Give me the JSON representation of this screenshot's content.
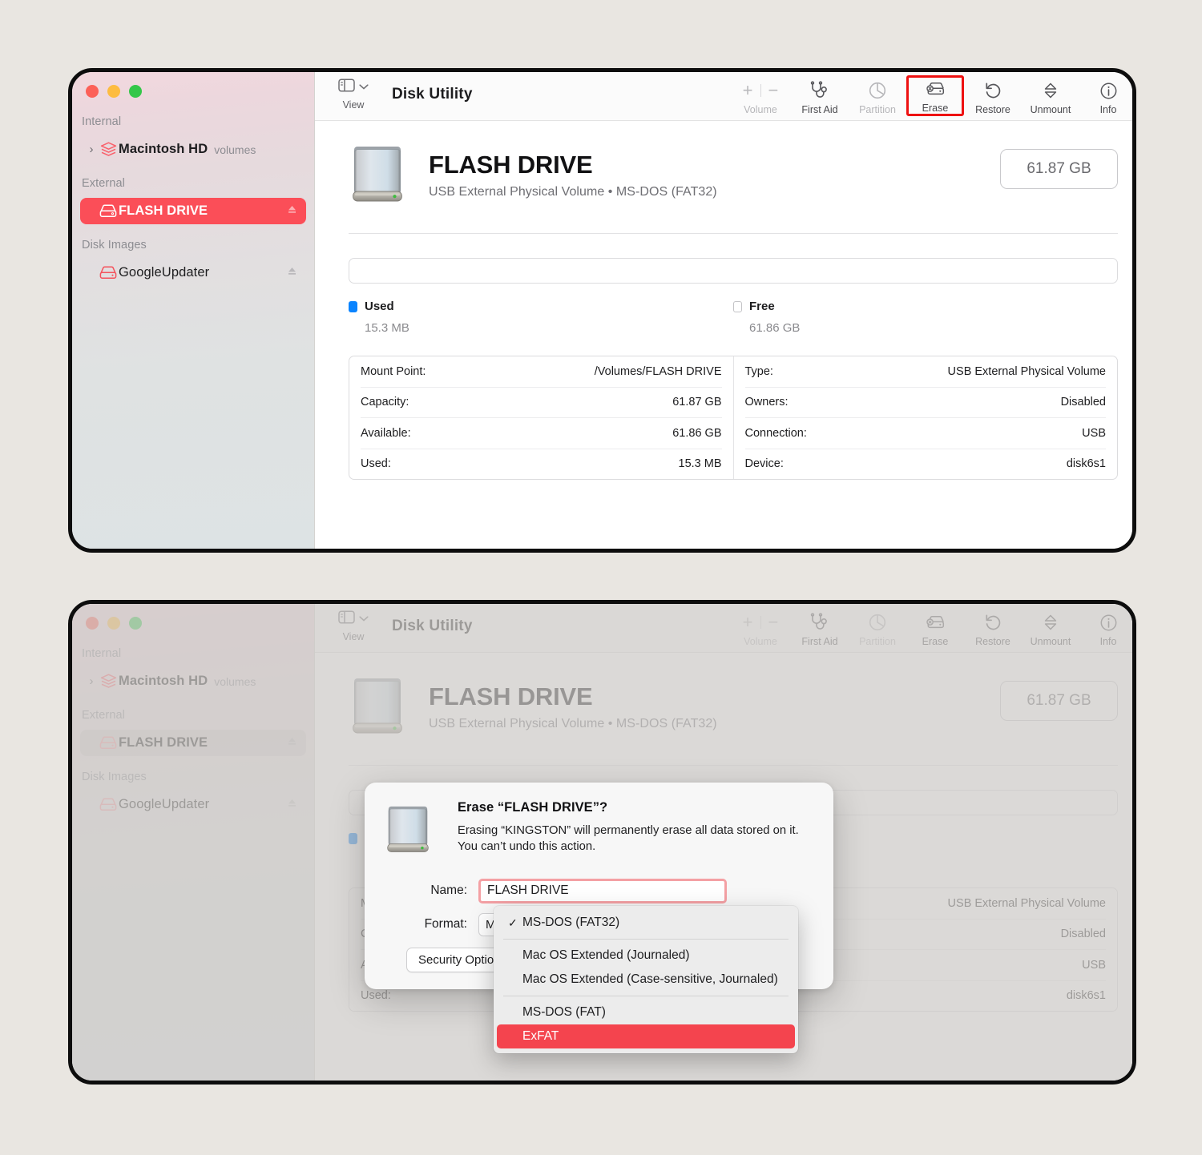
{
  "app": {
    "title": "Disk Utility",
    "view_label": "View"
  },
  "colors": {
    "selection_red": "#fb4e58",
    "highlight_red": "#ee1111",
    "dropdown_selected": "#f4444e",
    "used_blue": "#0a84ff",
    "field_focus_pink": "#f4a0a4"
  },
  "sidebar": {
    "sections": [
      {
        "title": "Internal",
        "items": [
          {
            "label": "Macintosh HD",
            "sub": "volumes",
            "icon": "stack-icon",
            "chevron": "chevron-right-icon",
            "selected": false,
            "eject": false
          }
        ]
      },
      {
        "title": "External",
        "items": [
          {
            "label": "FLASH DRIVE",
            "sub": "",
            "icon": "external-drive-icon",
            "chevron": "",
            "selected": true,
            "eject": true
          }
        ]
      },
      {
        "title": "Disk Images",
        "items": [
          {
            "label": "GoogleUpdater",
            "sub": "",
            "icon": "external-drive-icon",
            "chevron": "",
            "selected": false,
            "eject": true
          }
        ]
      }
    ]
  },
  "toolbar": {
    "volume": {
      "label": "Volume",
      "plus": "+",
      "minus": "−",
      "icon": "plus-minus-icon",
      "dimmed": true
    },
    "items": [
      {
        "label": "First Aid",
        "icon": "stethoscope-icon",
        "dimmed": false,
        "highlighted": false
      },
      {
        "label": "Partition",
        "icon": "pie-chart-icon",
        "dimmed": true,
        "highlighted": false
      },
      {
        "label": "Erase",
        "icon": "erase-drive-icon",
        "dimmed": false,
        "highlighted": true
      },
      {
        "label": "Restore",
        "icon": "restore-arrow-icon",
        "dimmed": false,
        "highlighted": false
      },
      {
        "label": "Unmount",
        "icon": "unmount-icon",
        "dimmed": false,
        "highlighted": false
      },
      {
        "label": "Info",
        "icon": "info-circle-icon",
        "dimmed": false,
        "highlighted": false
      }
    ]
  },
  "volume_header": {
    "name": "FLASH DRIVE",
    "subtitle": "USB External Physical Volume • MS-DOS (FAT32)",
    "capacity_badge": "61.87 GB",
    "icon": "external-drive-icon-large"
  },
  "capacity": {
    "legend": [
      {
        "name": "Used",
        "value": "15.3 MB",
        "swatch": "used"
      },
      {
        "name": "Free",
        "value": "61.86 GB",
        "swatch": "free"
      }
    ]
  },
  "info": {
    "left": [
      {
        "key": "Mount Point:",
        "value": "/Volumes/FLASH DRIVE"
      },
      {
        "key": "Capacity:",
        "value": "61.87 GB"
      },
      {
        "key": "Available:",
        "value": "61.86 GB"
      },
      {
        "key": "Used:",
        "value": "15.3 MB"
      }
    ],
    "right": [
      {
        "key": "Type:",
        "value": "USB External Physical Volume"
      },
      {
        "key": "Owners:",
        "value": "Disabled"
      },
      {
        "key": "Connection:",
        "value": "USB"
      },
      {
        "key": "Device:",
        "value": "disk6s1"
      }
    ]
  },
  "dialog": {
    "title": "Erase “FLASH DRIVE”?",
    "message": "Erasing “KINGSTON” will permanently erase all data stored on it. You can’t undo this action.",
    "name_label": "Name:",
    "name_value": "FLASH DRIVE",
    "format_label": "Format:",
    "format_value": "MS-DOS (FAT32)",
    "security_options_label": "Security Options...",
    "icon": "external-drive-icon-dialog"
  },
  "format_dropdown": {
    "options": [
      {
        "label": "MS-DOS (FAT32)",
        "checked": true,
        "selected": false,
        "separator_after": true
      },
      {
        "label": "Mac OS Extended (Journaled)",
        "checked": false,
        "selected": false,
        "separator_after": false
      },
      {
        "label": "Mac OS Extended (Case-sensitive, Journaled)",
        "checked": false,
        "selected": false,
        "separator_after": true
      },
      {
        "label": "MS-DOS (FAT)",
        "checked": false,
        "selected": false,
        "separator_after": false
      },
      {
        "label": "ExFAT",
        "checked": false,
        "selected": true,
        "separator_after": false
      }
    ]
  }
}
